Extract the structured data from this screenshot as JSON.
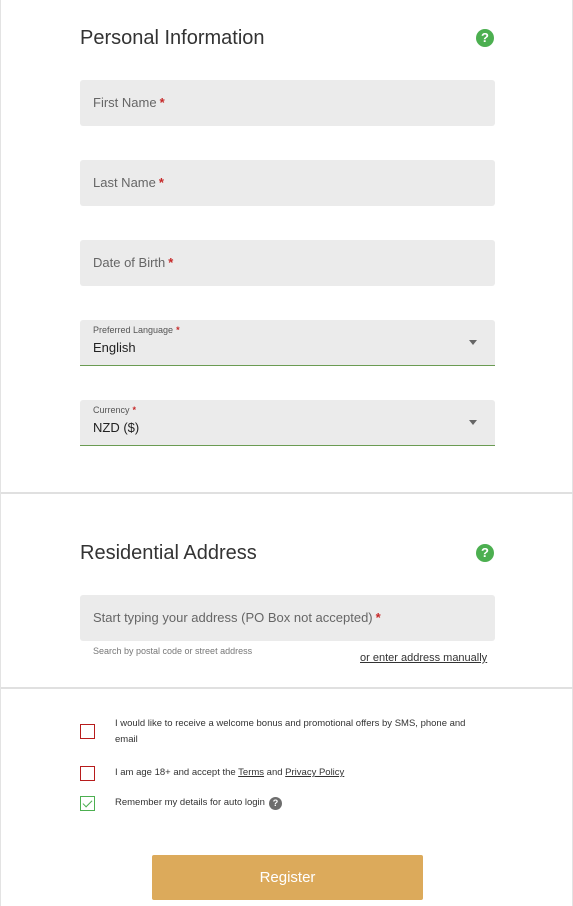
{
  "personal": {
    "title": "Personal Information",
    "help": "?",
    "first_name": "First Name",
    "last_name": "Last Name",
    "dob": "Date of Birth",
    "required_mark": "*",
    "language": {
      "label": "Preferred Language",
      "value": "English"
    },
    "currency": {
      "label": "Currency",
      "value": "NZD ($)"
    }
  },
  "address": {
    "title": "Residential Address",
    "help": "?",
    "placeholder": "Start typing your address (PO Box not accepted)",
    "hint": "Search by postal code or street address",
    "manual_link": "or enter address manually"
  },
  "consents": {
    "promo_line1": "I would like to receive a welcome bonus and promotional offers by SMS, phone and",
    "promo_line2": "email",
    "age_prefix": "I am age 18+ and accept the",
    "terms": "Terms",
    "and": "and",
    "privacy": "Privacy Policy",
    "remember": "Remember my details for auto login",
    "remember_help": "?"
  },
  "register_label": "Register",
  "colors": {
    "accent_green": "#4caf50",
    "button": "#dcaa5b",
    "error_red": "#c62828"
  }
}
